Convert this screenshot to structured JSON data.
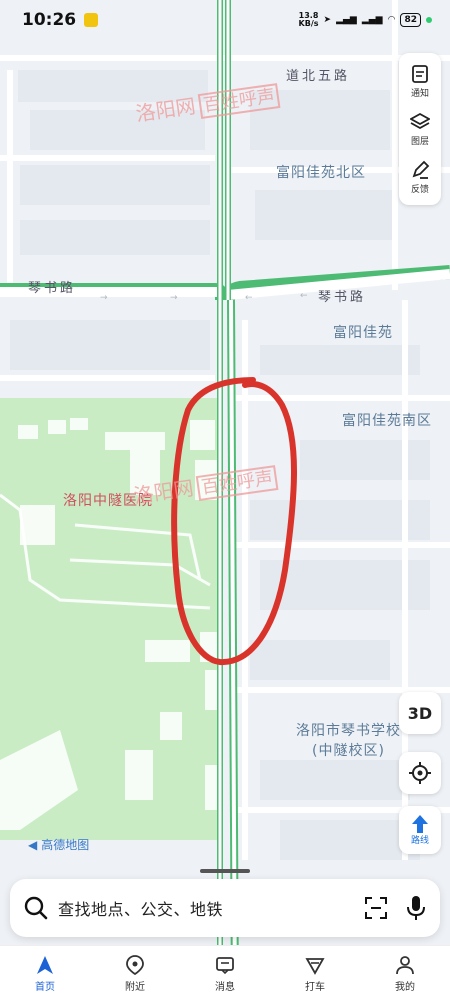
{
  "status_bar": {
    "time": "10:26",
    "net_speed_value": "13.8",
    "net_speed_unit": "KB/s",
    "battery": "82"
  },
  "map": {
    "roads": {
      "daobei": "道北五路",
      "qinshu_left": "琴书路",
      "qinshu_right": "琴书路"
    },
    "places": {
      "fuyang_north": "富阳佳苑北区",
      "fuyang": "富阳佳苑",
      "fuyang_south": "富阳佳苑南区",
      "hospital": "洛阳中隧医院",
      "school_line1": "洛阳市琴书学校",
      "school_line2": "(中隧校区)"
    },
    "logo": "高德地图"
  },
  "watermark": {
    "text": "洛阳网",
    "box": "百姓呼声"
  },
  "controls": {
    "notify": "通知",
    "layers": "图层",
    "feedback": "反馈",
    "three_d": "3D",
    "route": "路线"
  },
  "search": {
    "placeholder": "查找地点、公交、地铁"
  },
  "tabs": [
    {
      "label": "首页"
    },
    {
      "label": "附近"
    },
    {
      "label": "消息"
    },
    {
      "label": "打车"
    },
    {
      "label": "我的"
    }
  ],
  "colors": {
    "accent": "#1e63d6",
    "park": "#c9ecc5",
    "road_outline": "#4dbb73",
    "annotation": "#d9342b"
  }
}
